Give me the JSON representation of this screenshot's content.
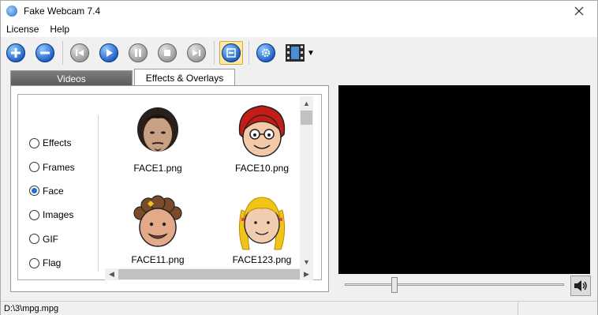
{
  "window": {
    "title": "Fake Webcam 7.4"
  },
  "menu": {
    "items": [
      "License",
      "Help"
    ]
  },
  "toolbar": {
    "add": "+",
    "remove": "−"
  },
  "tabs": [
    {
      "label": "Videos",
      "active": false
    },
    {
      "label": "Effects & Overlays",
      "active": true
    }
  ],
  "effects": {
    "options": [
      {
        "label": "Effects",
        "checked": false
      },
      {
        "label": "Frames",
        "checked": false
      },
      {
        "label": "Face",
        "checked": true
      },
      {
        "label": "Images",
        "checked": false
      },
      {
        "label": "GIF",
        "checked": false
      },
      {
        "label": "Flag",
        "checked": false
      }
    ],
    "items": [
      {
        "label": "FACE1.png",
        "icon": "photo-face-icon"
      },
      {
        "label": "FACE10.png",
        "icon": "cartoon-face-red-hair-glasses-icon"
      },
      {
        "label": "FACE11.png",
        "icon": "cartoon-face-curly-brown-hair-icon"
      },
      {
        "label": "FACE123.png",
        "icon": "cartoon-face-blonde-pigtails-icon"
      }
    ]
  },
  "player": {
    "volume_icon": "speaker-icon",
    "position": 0.22
  },
  "status": {
    "path": "D:\\3\\mpg.mpg"
  },
  "colors": {
    "accent": "#1f5fc4",
    "preview_bg": "#000000",
    "active_tool": "#fde9a8"
  }
}
